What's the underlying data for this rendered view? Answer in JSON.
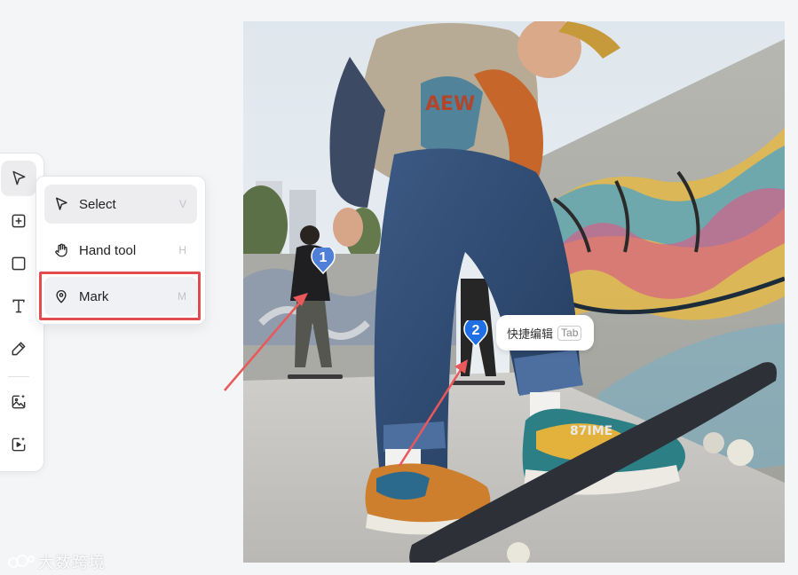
{
  "toolbar": {
    "tools": [
      {
        "name": "select-tool",
        "icon": "cursor-arrow-icon",
        "active": true
      },
      {
        "name": "add-frame-tool",
        "icon": "plus-square-icon"
      },
      {
        "name": "rectangle-tool",
        "icon": "square-icon"
      },
      {
        "name": "text-tool",
        "icon": "text-t-icon"
      },
      {
        "name": "pen-tool",
        "icon": "pencil-icon"
      },
      {
        "name": "ai-image-tool",
        "icon": "image-sparkle-icon"
      },
      {
        "name": "ai-video-tool",
        "icon": "video-sparkle-icon"
      }
    ]
  },
  "tool_menu": {
    "items": [
      {
        "label": "Select",
        "shortcut": "V",
        "icon": "cursor-arrow-icon"
      },
      {
        "label": "Hand tool",
        "shortcut": "H",
        "icon": "hand-icon"
      },
      {
        "label": "Mark",
        "shortcut": "M",
        "icon": "map-pin-icon"
      }
    ],
    "highlighted": "Mark",
    "highlight_color": "#e24b50"
  },
  "canvas": {
    "image_subject": "skateboarders at a graffiti skatepark",
    "markers": [
      {
        "number": "1",
        "color": "#4f7fd6"
      },
      {
        "number": "2",
        "color": "#1f6fe6"
      }
    ],
    "quick_edit": {
      "label": "快捷编辑",
      "key": "Tab"
    },
    "annotation_arrow_color": "#e9585a"
  },
  "watermark": {
    "text": "大数跨境"
  }
}
